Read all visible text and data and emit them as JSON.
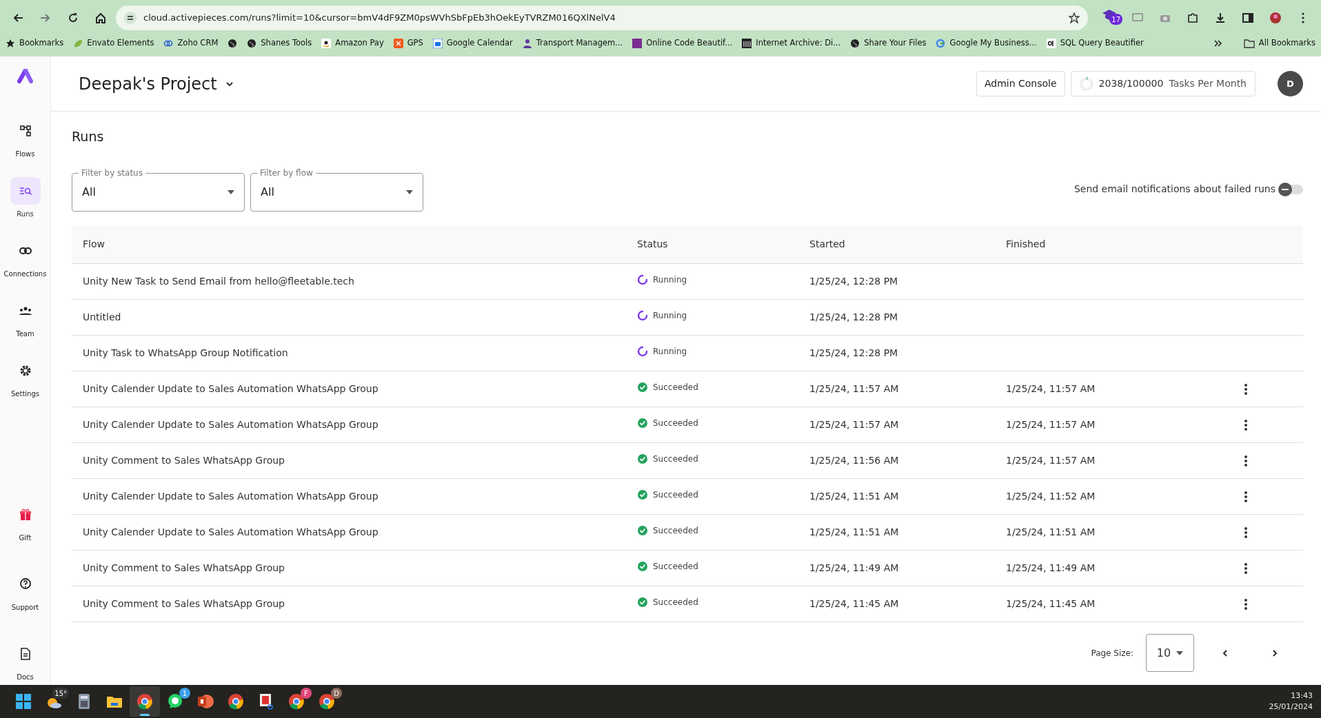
{
  "browser": {
    "url": "cloud.activepieces.com/runs?limit=10&cursor=bmV4dF9ZM0psWVhSbFpEb3hOekEyTVRZM016QXlNelV4",
    "extension_badge": "17",
    "bookmarks": [
      {
        "label": "Bookmarks",
        "kind": "star"
      },
      {
        "label": "Envato Elements",
        "kind": "leaf"
      },
      {
        "label": "Zoho CRM",
        "kind": "rings"
      },
      {
        "kind": "globe"
      },
      {
        "label": "Shanes Tools",
        "kind": "globe"
      },
      {
        "label": "Amazon Pay",
        "kind": "amazon"
      },
      {
        "label": "GPS",
        "kind": "orange"
      },
      {
        "label": "Google Calendar",
        "kind": "calendar"
      },
      {
        "label": "Transport Managem...",
        "kind": "person"
      },
      {
        "label": "Online Code Beautif...",
        "kind": "tile"
      },
      {
        "label": "Internet Archive: Di...",
        "kind": "archive"
      },
      {
        "label": "Share Your Files",
        "kind": "globe"
      },
      {
        "label": "Google My Business...",
        "kind": "google"
      },
      {
        "label": "SQL Query Beautifier",
        "kind": "cb"
      }
    ],
    "all_bookmarks": "All Bookmarks"
  },
  "sidebar": {
    "items": [
      {
        "label": "Flows",
        "kind": "flows",
        "selected": false
      },
      {
        "label": "Runs",
        "kind": "runs",
        "selected": true
      },
      {
        "label": "Connections",
        "kind": "link",
        "selected": false
      },
      {
        "label": "Team",
        "kind": "team",
        "selected": false
      },
      {
        "label": "Settings",
        "kind": "gear",
        "selected": false
      }
    ],
    "bottom_items": [
      {
        "label": "Gift",
        "kind": "gift"
      },
      {
        "label": "Support",
        "kind": "help"
      },
      {
        "label": "Docs",
        "kind": "doc"
      }
    ]
  },
  "header": {
    "project": "Deepak's Project",
    "admin_button": "Admin Console",
    "usage": {
      "count": "2038/100000",
      "label": "Tasks Per Month",
      "level": 0.02
    },
    "avatar": "D"
  },
  "page_title": "Runs",
  "filters": [
    {
      "label": "Filter by status",
      "value": "All"
    },
    {
      "label": "Filter by flow",
      "value": "All"
    }
  ],
  "notifications": {
    "label": "Send email notifications about failed runs",
    "on": false
  },
  "table": {
    "columns": [
      "Flow",
      "Status",
      "Started",
      "Finished"
    ],
    "rows": [
      {
        "flow": "Unity New Task to Send Email from hello@fleetable.tech",
        "kind": "running",
        "status_label": "Running",
        "started": "1/25/24, 12:28 PM",
        "actions": false
      },
      {
        "flow": "Untitled",
        "kind": "running",
        "status_label": "Running",
        "started": "1/25/24, 12:28 PM",
        "actions": false
      },
      {
        "flow": "Unity Task to WhatsApp Group Notification",
        "kind": "running",
        "status_label": "Running",
        "started": "1/25/24, 12:28 PM",
        "actions": false
      },
      {
        "flow": "Unity Calender Update to Sales Automation WhatsApp Group",
        "kind": "succeeded",
        "status_label": "Succeeded",
        "started": "1/25/24, 11:57 AM",
        "finished": "1/25/24, 11:57 AM",
        "actions": true
      },
      {
        "flow": "Unity Calender Update to Sales Automation WhatsApp Group",
        "kind": "succeeded",
        "status_label": "Succeeded",
        "started": "1/25/24, 11:57 AM",
        "finished": "1/25/24, 11:57 AM",
        "actions": true
      },
      {
        "flow": "Unity Comment to Sales WhatsApp Group",
        "kind": "succeeded",
        "status_label": "Succeeded",
        "started": "1/25/24, 11:56 AM",
        "finished": "1/25/24, 11:57 AM",
        "actions": true
      },
      {
        "flow": "Unity Calender Update to Sales Automation WhatsApp Group",
        "kind": "succeeded",
        "status_label": "Succeeded",
        "started": "1/25/24, 11:51 AM",
        "finished": "1/25/24, 11:52 AM",
        "actions": true
      },
      {
        "flow": "Unity Calender Update to Sales Automation WhatsApp Group",
        "kind": "succeeded",
        "status_label": "Succeeded",
        "started": "1/25/24, 11:51 AM",
        "finished": "1/25/24, 11:51 AM",
        "actions": true
      },
      {
        "flow": "Unity Comment to Sales WhatsApp Group",
        "kind": "succeeded",
        "status_label": "Succeeded",
        "started": "1/25/24, 11:49 AM",
        "finished": "1/25/24, 11:49 AM",
        "actions": true
      },
      {
        "flow": "Unity Comment to Sales WhatsApp Group",
        "kind": "succeeded",
        "status_label": "Succeeded",
        "started": "1/25/24, 11:45 AM",
        "finished": "1/25/24, 11:45 AM",
        "actions": true
      }
    ]
  },
  "pagination": {
    "label": "Page Size:",
    "value": "10"
  },
  "taskbar": {
    "apps": [
      {
        "kind": "start",
        "active": false
      },
      {
        "kind": "weather",
        "badge": "15°",
        "active": false
      },
      {
        "kind": "calculator",
        "active": false
      },
      {
        "kind": "folder",
        "active": false
      },
      {
        "kind": "chrome",
        "active": true
      },
      {
        "kind": "whatsapp",
        "badge": "1",
        "active": false
      },
      {
        "kind": "powerpoint",
        "active": false
      },
      {
        "kind": "chrome",
        "active": false
      },
      {
        "kind": "snip",
        "active": false
      },
      {
        "kind": "chrome",
        "badge": "F",
        "active": false
      },
      {
        "kind": "chrome",
        "badge": "D",
        "active": false
      }
    ],
    "time": "13:43",
    "date": "25/01/2024"
  }
}
